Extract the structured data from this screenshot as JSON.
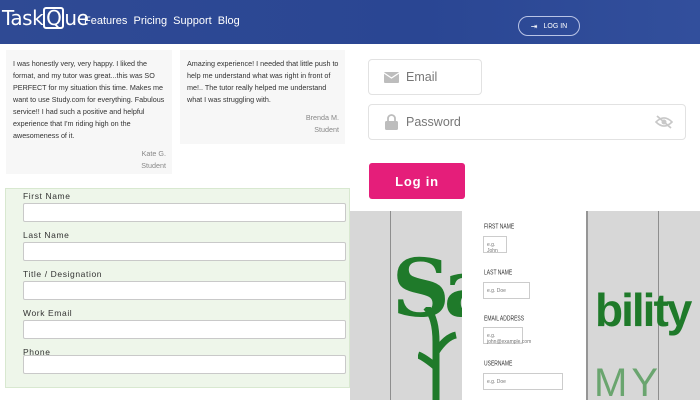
{
  "header": {
    "logo_text_pre": "Task",
    "logo_text_mid": "Q",
    "logo_text_post": "ue",
    "nav": [
      "Features",
      "Pricing",
      "Support",
      "Blog"
    ],
    "login_label": "LOG IN"
  },
  "testimonials": [
    {
      "text": "I was honestly very, very happy. I liked the format, and my tutor was great...this was SO PERFECT for my situation this time. Makes me want to use Study.com for everything. Fabulous service!! I had such a positive and helpful experience that I'm riding high on the awesomeness of it.",
      "author": "Kate G.",
      "role": "Student"
    },
    {
      "text": "Amazing experience! I needed that little push to help me understand what was right in front of me!.. The tutor really helped me understand what I was struggling with.",
      "author": "Brenda M.",
      "role": "Student"
    }
  ],
  "login": {
    "email_placeholder": "Email",
    "password_placeholder": "Password",
    "button_label": "Log in"
  },
  "lead_form": {
    "fields": [
      {
        "label": "First Name"
      },
      {
        "label": "Last Name"
      },
      {
        "label": "Title / Designation"
      },
      {
        "label": "Work Email"
      },
      {
        "label": "Phone"
      }
    ]
  },
  "preview": {
    "brand_left": "Sa",
    "brand_right": "bility",
    "brand_right_2": "MY",
    "mini_form": [
      {
        "label": "FIRST NAME",
        "placeholder": "e.g. John"
      },
      {
        "label": "LAST NAME",
        "placeholder": "e.g. Doe"
      },
      {
        "label": "EMAIL ADDRESS",
        "placeholder": "e.g. john@example.com"
      },
      {
        "label": "USERNAME",
        "placeholder": "e.g. Doe"
      }
    ]
  },
  "colors": {
    "header_bg": "#2f4a94",
    "accent_pink": "#e51e7a",
    "form_bg": "#eef6ea",
    "brand_green": "#1f7a2a"
  }
}
